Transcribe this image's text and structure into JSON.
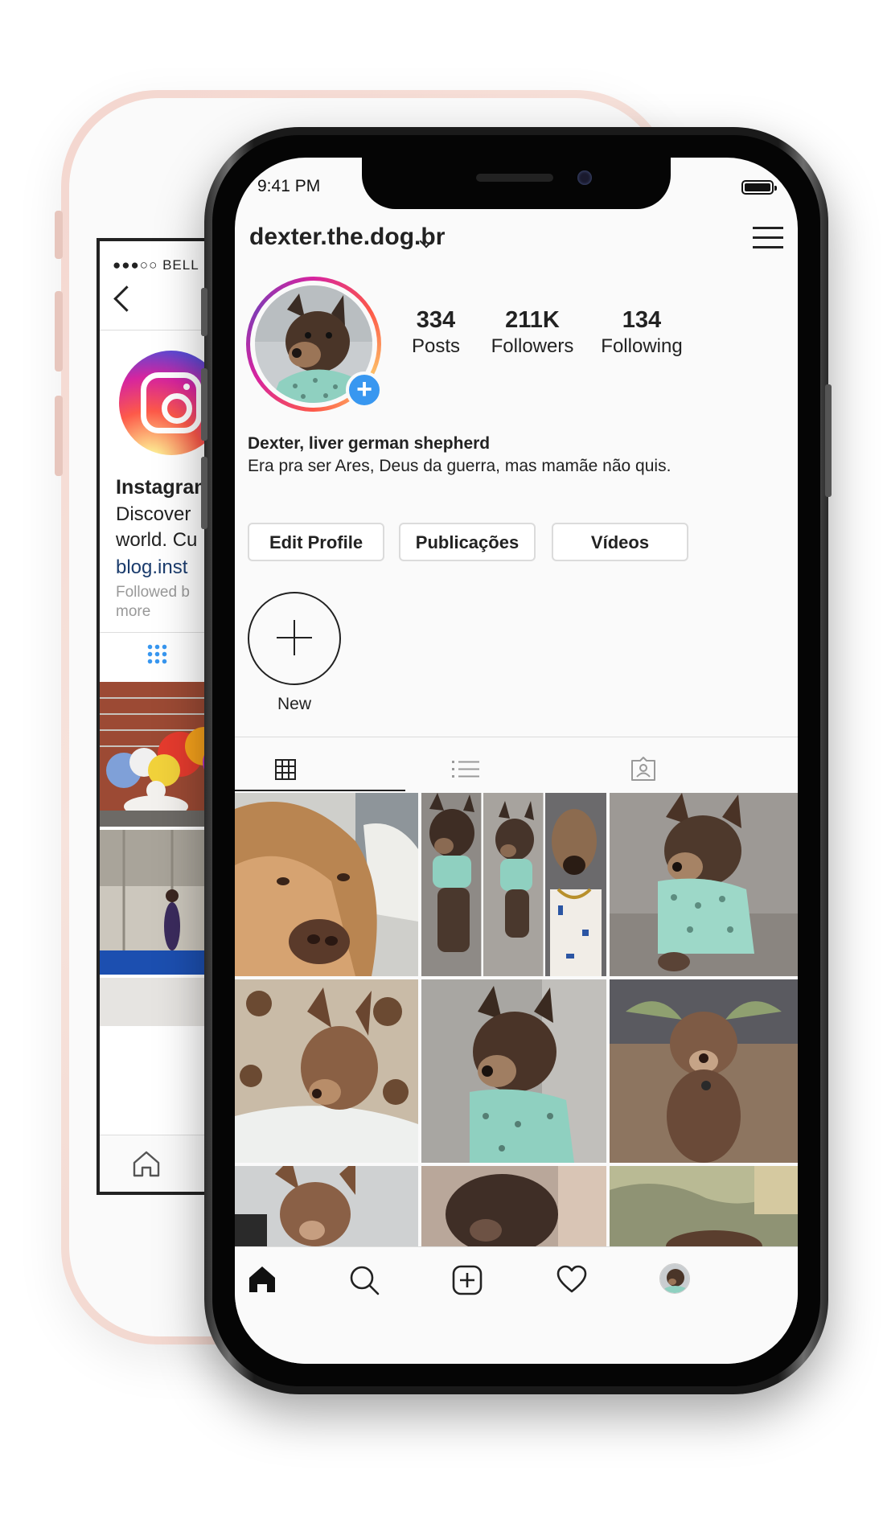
{
  "back_app": {
    "status": "●●●○○ BELL",
    "profile_name": "Instagram",
    "description_line1": "Discover",
    "description_line2": "world. Cu",
    "link": "blog.inst",
    "followed_by_line1": "Followed b",
    "followed_by_line2": "more"
  },
  "status_bar": {
    "time": "9:41 PM"
  },
  "profile": {
    "username": "dexter.the.dog.br",
    "posts_count": "334",
    "posts_label": "Posts",
    "followers_count": "211K",
    "followers_label": "Followers",
    "following_count": "134",
    "following_label": "Following",
    "bio_name": "Dexter, liver german shepherd",
    "bio_text": "Era pra ser Ares, Deus da guerra, mas mamãe não quis."
  },
  "buttons": {
    "edit_profile": "Edit Profile",
    "publicacoes": "Publicações",
    "videos": "Vídeos"
  },
  "story_highlight": {
    "new_label": "New"
  },
  "icons": {
    "grid": "grid-icon",
    "list": "list-icon",
    "tagged": "tagged-icon",
    "home": "home-icon",
    "search": "search-icon",
    "add": "add-post-icon",
    "activity": "heart-icon",
    "profile": "profile-avatar-icon",
    "menu": "hamburger-menu-icon"
  },
  "colors": {
    "accent_blue": "#3897f0",
    "text": "#222222",
    "border": "#dbdbdb",
    "back_phone": "#f4d6cf"
  }
}
